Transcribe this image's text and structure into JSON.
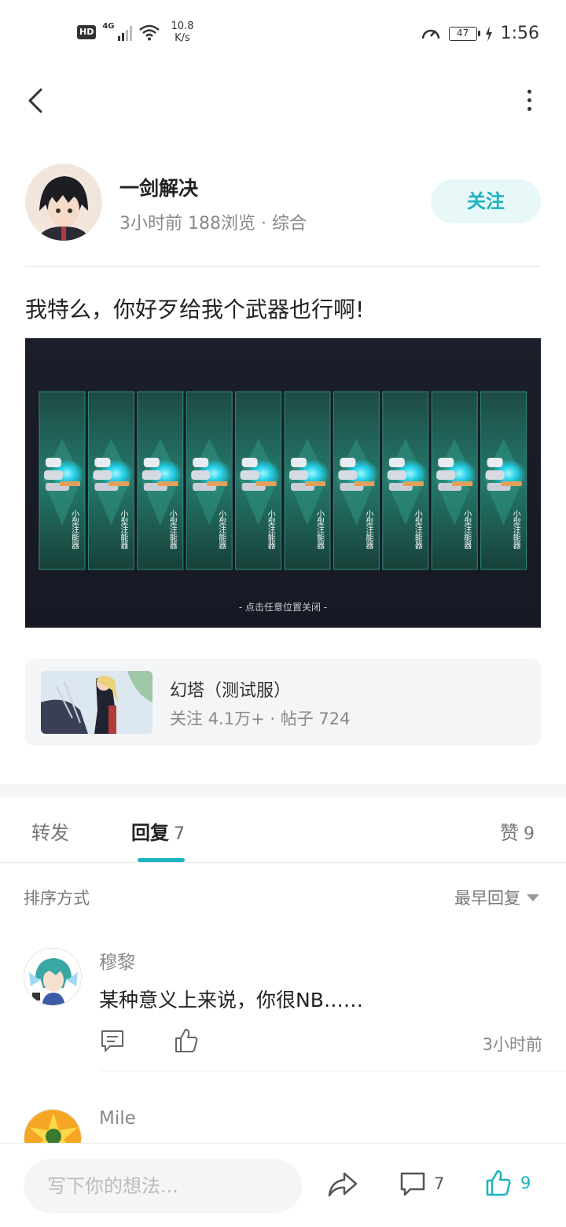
{
  "status_bar": {
    "hd": "HD",
    "network": "4G",
    "speed_value": "10.8",
    "speed_unit": "K/s",
    "battery": "47",
    "time": "1:56"
  },
  "author": {
    "name": "一剑解决",
    "time": "3小时前",
    "views": "188浏览",
    "separator": "·",
    "category": "综合",
    "follow_label": "关注"
  },
  "post": {
    "text": "我特么，你好歹给我个武器也行啊!",
    "image": {
      "item_label": "小型注能器",
      "item_count": 10,
      "footer_text": "- 点击任意位置关闭 -"
    }
  },
  "forum": {
    "name": "幻塔（测试服）",
    "follow_stat": "关注 4.1万+",
    "separator": "·",
    "posts_stat": "帖子 724"
  },
  "tabs": {
    "repost": "转发",
    "reply": "回复",
    "reply_count": "7",
    "like": "赞",
    "like_count": "9"
  },
  "sort": {
    "label": "排序方式",
    "value": "最早回复"
  },
  "comments": [
    {
      "name": "穆黎",
      "text": "某种意义上来说，你很NB……",
      "time": "3小时前"
    },
    {
      "name": "Mile"
    }
  ],
  "bottom_bar": {
    "placeholder": "写下你的想法...",
    "comment_count": "7",
    "like_count": "9"
  },
  "colors": {
    "accent": "#1cb3bf",
    "accent_light": "#e8f7f7",
    "panel_bg": "#f4f5f7"
  }
}
